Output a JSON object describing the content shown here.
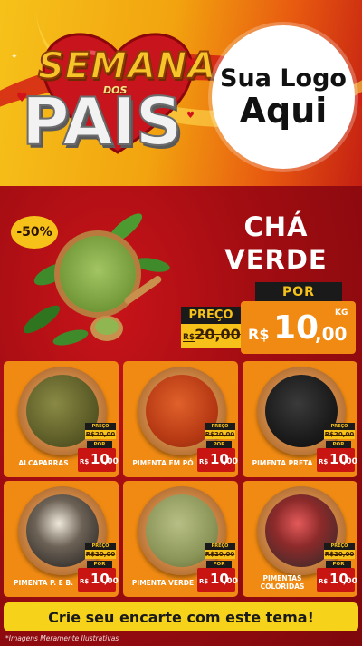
{
  "header": {
    "logo_top": "SEMANA",
    "logo_mid": "DOS",
    "logo_bottom": "PAIS",
    "brand_line1": "Sua Logo",
    "brand_line2": "Aqui"
  },
  "featured": {
    "discount": "-50%",
    "title_line1": "CHÁ",
    "title_line2": "VERDE",
    "old_label": "PREÇO",
    "old_currency": "R$",
    "old_value": "20,00",
    "por_label": "POR",
    "currency": "R$",
    "price_int": "10",
    "price_dec": ",00",
    "unit": "KG"
  },
  "products": [
    {
      "name": "ALCAPARRAS",
      "old_label": "PREÇO",
      "old_value": "R$20,00",
      "por_label": "POR",
      "currency": "R$",
      "price_int": "10",
      "price_dec": ",00",
      "unit": "KG"
    },
    {
      "name": "PIMENTA EM PÓ",
      "old_label": "PREÇO",
      "old_value": "R$20,00",
      "por_label": "POR",
      "currency": "R$",
      "price_int": "10",
      "price_dec": ",00",
      "unit": "KG"
    },
    {
      "name": "PIMENTA PRETA",
      "old_label": "PREÇO",
      "old_value": "R$20,00",
      "por_label": "POR",
      "currency": "R$",
      "price_int": "10",
      "price_dec": ",00",
      "unit": "KG"
    },
    {
      "name": "PIMENTA P. E B.",
      "old_label": "PREÇO",
      "old_value": "R$20,00",
      "por_label": "POR",
      "currency": "R$",
      "price_int": "10",
      "price_dec": ",00",
      "unit": "KG"
    },
    {
      "name": "PIMENTA VERDE",
      "old_label": "PREÇO",
      "old_value": "R$20,00",
      "por_label": "POR",
      "currency": "R$",
      "price_int": "10",
      "price_dec": ",00",
      "unit": "KG"
    },
    {
      "name": "PIMENTAS COLORIDAS",
      "old_label": "PREÇO",
      "old_value": "R$20,00",
      "por_label": "POR",
      "currency": "R$",
      "price_int": "10",
      "price_dec": ",00",
      "unit": "KG"
    }
  ],
  "footer": {
    "cta": "Crie seu encarte com este tema!",
    "disclaimer": "*Imagens Meramente Ilustrativas"
  },
  "colors": {
    "background_red": "#a30d12",
    "card_orange": "#f08a12",
    "badge_yellow": "#f6c21a",
    "price_red": "#c91512",
    "cta_yellow": "#f6d21a"
  }
}
